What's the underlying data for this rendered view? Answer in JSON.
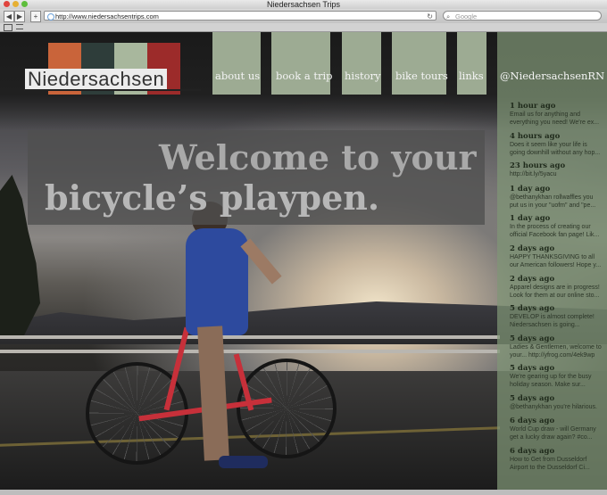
{
  "window": {
    "title": "Niedersachsen Trips"
  },
  "toolbar": {
    "back_icon": "back-arrow-icon",
    "forward_icon": "forward-arrow-icon",
    "add_label": "+",
    "url": "http://www.niedersachsentrips.com",
    "reload_glyph": "↻",
    "search_placeholder": "Google"
  },
  "logo": {
    "text": "Niedersachsen",
    "bar_colors": [
      "#c9643a",
      "#2e3d3a",
      "#a8b79d",
      "#9c2b2a"
    ]
  },
  "nav": {
    "items": [
      {
        "label": "about us"
      },
      {
        "label": "book a trip"
      },
      {
        "label": "history"
      },
      {
        "label": "bike tours"
      },
      {
        "label": "links"
      }
    ],
    "twitter_handle": "@NiedersachsenRN",
    "tab_color": "#a8b79d"
  },
  "hero": {
    "line1": "Welcome to your",
    "line2": "bicycle’s playpen."
  },
  "tweets": [
    {
      "time": "1 hour ago",
      "text": "Email us for anything and\neverything you need! We're ex..."
    },
    {
      "time": "4 hours ago",
      "text": "Does it seem like your life is\ngoing downhill without any hop..."
    },
    {
      "time": "23 hours ago",
      "text": "http://bit.ly/5yacu"
    },
    {
      "time": "1 day ago",
      "text": "@bethanykhan rollwaffles you\nput us in your \"uofm\" and \"pe..."
    },
    {
      "time": "1 day ago",
      "text": "In the process of creating our\nofficial Facebook fan page! Lik..."
    },
    {
      "time": "2 days ago",
      "text": "HAPPY THANKSGIVING to all\nour American followers! Hope y..."
    },
    {
      "time": "2 days ago",
      "text": "Apparel designs are in progress!\nLook for them at our online sto..."
    },
    {
      "time": "5 days ago",
      "text": "DEVELOP is almost complete!\nNiedersachsen is going..."
    },
    {
      "time": "5 days ago",
      "text": "Ladies & Gentlemen, welcome to\nyour... http://yfrog.com/4ek9wp"
    },
    {
      "time": "5 days ago",
      "text": "We're gearing up for the busy\nholiday season. Make sur..."
    },
    {
      "time": "5 days ago",
      "text": "@bethanykhan you're hilarious."
    },
    {
      "time": "6 days ago",
      "text": "World Cup draw - will Germany\nget a lucky draw again? #co..."
    },
    {
      "time": "6 days ago",
      "text": "How to Get from Dusseldorf\nAirport to the Dusseldorf Ci..."
    }
  ],
  "colors": {
    "sidebar": "#80967a",
    "hero_box": "#505050",
    "frame_red": "#c7303a"
  }
}
